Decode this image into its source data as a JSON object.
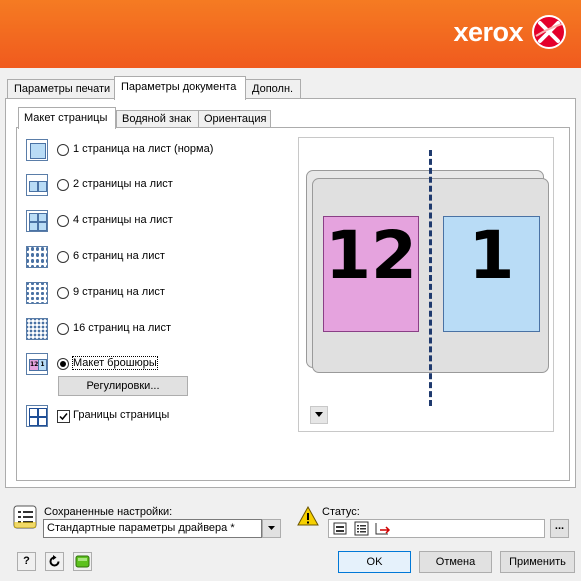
{
  "brand": {
    "name": "xerox"
  },
  "tabs": {
    "outer": [
      "Параметры печати",
      "Параметры документа",
      "Дополн."
    ],
    "inner": [
      "Макет страницы",
      "Водяной знак",
      "Ориентация"
    ]
  },
  "options": {
    "layout_1": "1 страница на лист (норма)",
    "layout_2": "2 страницы на лист",
    "layout_4": "4 страницы на лист",
    "layout_6": "6 страниц на лист",
    "layout_9": "9 страниц на лист",
    "layout_16": "16 страниц на лист",
    "booklet": "Макет брошюры",
    "adjust_button": "Регулировки...",
    "page_borders": "Границы страницы"
  },
  "preview": {
    "left_page": "12",
    "right_page": "1"
  },
  "saved": {
    "label": "Сохраненные настройки:",
    "value": "Стандартные параметры драйвера *"
  },
  "status": {
    "label": "Статус:",
    "more": "..."
  },
  "buttons": {
    "help": "?",
    "ok": "OK",
    "cancel": "Отмена",
    "apply": "Применить"
  },
  "colors": {
    "header": "#f26522",
    "left_page": "#e5a3de",
    "right_page": "#b9dcf6"
  }
}
